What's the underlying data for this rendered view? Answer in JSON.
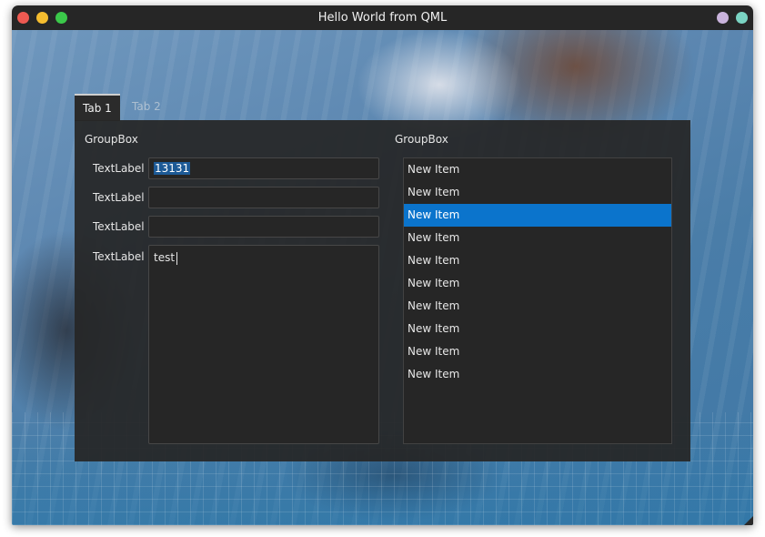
{
  "window": {
    "title": "Hello World from QML"
  },
  "tabs": [
    {
      "label": "Tab 1",
      "active": true
    },
    {
      "label": "Tab 2",
      "active": false
    }
  ],
  "left_group": {
    "title": "GroupBox",
    "rows": [
      {
        "label": "TextLabel",
        "value": "13131",
        "selected": true
      },
      {
        "label": "TextLabel",
        "value": ""
      },
      {
        "label": "TextLabel",
        "value": ""
      },
      {
        "label": "TextLabel",
        "value": "test",
        "multiline": true
      }
    ]
  },
  "right_group": {
    "title": "GroupBox",
    "items": [
      "New Item",
      "New Item",
      "New Item",
      "New Item",
      "New Item",
      "New Item",
      "New Item",
      "New Item",
      "New Item",
      "New Item"
    ],
    "selected_index": 2
  },
  "colors": {
    "selection": "#0b74cc",
    "panel": "#262626",
    "close": "#ee5a52",
    "minimize": "#f5bd2f",
    "maximize": "#3bc84a"
  }
}
